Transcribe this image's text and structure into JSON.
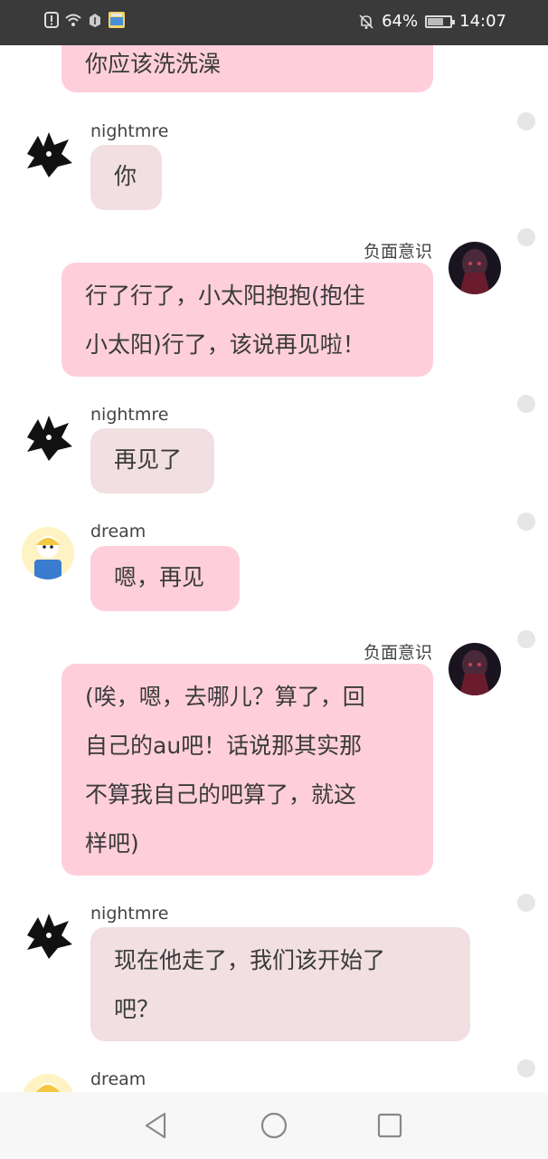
{
  "status_bar": {
    "left_icons": [
      "alert-icon",
      "wifi-icon",
      "app-icon",
      "app-notification-icon"
    ],
    "mute_icon": "bell-off-icon",
    "battery_percent": "64%",
    "battery_level": 0.64,
    "time": "14:07"
  },
  "messages": [
    {
      "side": "right",
      "name": "",
      "text": "你应该洗洗澡",
      "style": "pink",
      "partial": true
    },
    {
      "side": "left",
      "name": "nightmre",
      "avatar": "nightmare-avatar",
      "text": "你",
      "style": "gray"
    },
    {
      "side": "right",
      "name": "负面意识",
      "avatar": "negative-avatar",
      "lines": [
        "行了行了，小太阳抱抱(抱住",
        "小太阳)行了，该说再见啦！"
      ],
      "style": "pink"
    },
    {
      "side": "left",
      "name": "nightmre",
      "avatar": "nightmare-avatar",
      "text": "再见了",
      "style": "gray"
    },
    {
      "side": "left",
      "name": "dream",
      "avatar": "dream-avatar",
      "text": "嗯，再见",
      "style": "pink"
    },
    {
      "side": "right",
      "name": "负面意识",
      "avatar": "negative-avatar",
      "lines": [
        "(唉，嗯，去哪儿？算了，回",
        "自己的au吧！话说那其实那",
        "不算我自己的吧算了，就这",
        "样吧)"
      ],
      "style": "pink"
    },
    {
      "side": "left",
      "name": "nightmre",
      "avatar": "nightmare-avatar",
      "lines": [
        "现在他走了，我们该开始了",
        "吧？"
      ],
      "style": "gray"
    },
    {
      "side": "left",
      "name": "dream",
      "avatar": "dream-avatar",
      "text": "",
      "style": "pink",
      "partial": true
    }
  ],
  "nav_bar": {
    "back_icon": "back-triangle-icon",
    "home_icon": "home-circle-icon",
    "recents_icon": "recents-square-icon"
  },
  "colors": {
    "status_bar_bg": "#3a3a3a",
    "bubble_pink": "#fecfdb",
    "bubble_gray": "#f1dfe2",
    "nav_bg": "#f7f7f7"
  }
}
